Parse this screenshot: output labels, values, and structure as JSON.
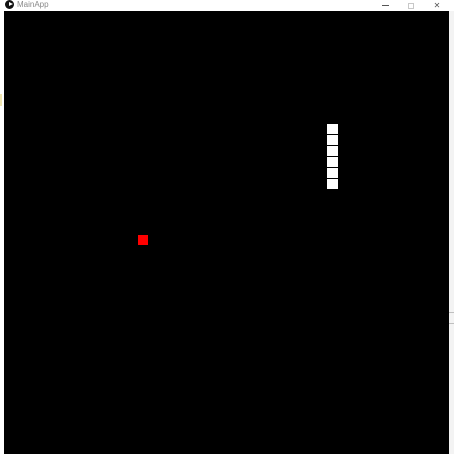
{
  "window": {
    "title": "MainApp",
    "icon": "play-circle-icon",
    "controls": {
      "minimize": "minimize-icon",
      "maximize": "maximize-icon",
      "close_glyph": "✕"
    }
  },
  "game": {
    "background_color": "#000000",
    "snake": {
      "color": "#ffffff",
      "segments": 6
    },
    "food": {
      "color": "#ff0000"
    }
  }
}
